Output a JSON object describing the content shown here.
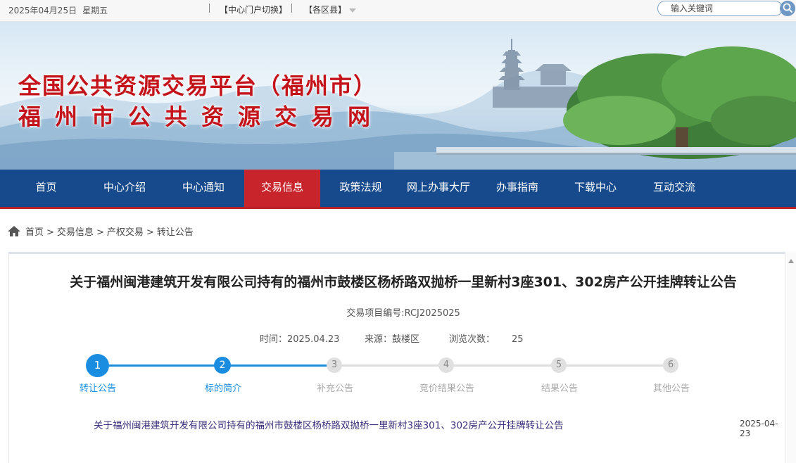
{
  "topbar": {
    "date": "2025年04月25日",
    "weekday": "星期五",
    "portal_switch": "【中心门户切换】",
    "county": "【各区县】",
    "search_placeholder": "输入关键词"
  },
  "banner": {
    "title_line1": "全国公共资源交易平台（福州市）",
    "title_line2": "福州市公共资源交易网"
  },
  "nav": {
    "items": [
      {
        "label": "首页"
      },
      {
        "label": "中心介绍"
      },
      {
        "label": "中心通知"
      },
      {
        "label": "交易信息"
      },
      {
        "label": "政策法规"
      },
      {
        "label": "网上办事大厅"
      },
      {
        "label": "办事指南"
      },
      {
        "label": "下载中心"
      },
      {
        "label": "互动交流"
      }
    ],
    "active": "交易信息"
  },
  "breadcrumb": {
    "items": [
      "首页",
      "交易信息",
      "产权交易",
      "转让公告"
    ],
    "separator": ">"
  },
  "article": {
    "title": "关于福州闽港建筑开发有限公司持有的福州市鼓楼区杨桥路双抛桥一里新村3座301、302房产公开挂牌转让公告",
    "project_code": "交易项目编号:RCJ2025025",
    "time_label": "时间：",
    "time_value": "2025.04.23",
    "source_label": "来源：",
    "source_value": "鼓楼区",
    "views_label": "浏览次数：",
    "views_value": "25"
  },
  "steps": {
    "current": 2,
    "items": [
      {
        "num": "1",
        "label": "转让公告"
      },
      {
        "num": "2",
        "label": "标的简介"
      },
      {
        "num": "3",
        "label": "补充公告"
      },
      {
        "num": "4",
        "label": "竞价结果公告"
      },
      {
        "num": "5",
        "label": "结果公告"
      },
      {
        "num": "6",
        "label": "其他公告"
      }
    ]
  },
  "list": {
    "items": [
      {
        "title": "关于福州闽港建筑开发有限公司持有的福州市鼓楼区杨桥路双抛桥一里新村3座301、302房产公开挂牌转让公告",
        "date": "2025-04-23"
      }
    ]
  },
  "colors": {
    "nav_bg": "#164a8c",
    "nav_active": "#c8242b",
    "title_red": "#c4141b",
    "step_blue": "#1a8de0"
  }
}
